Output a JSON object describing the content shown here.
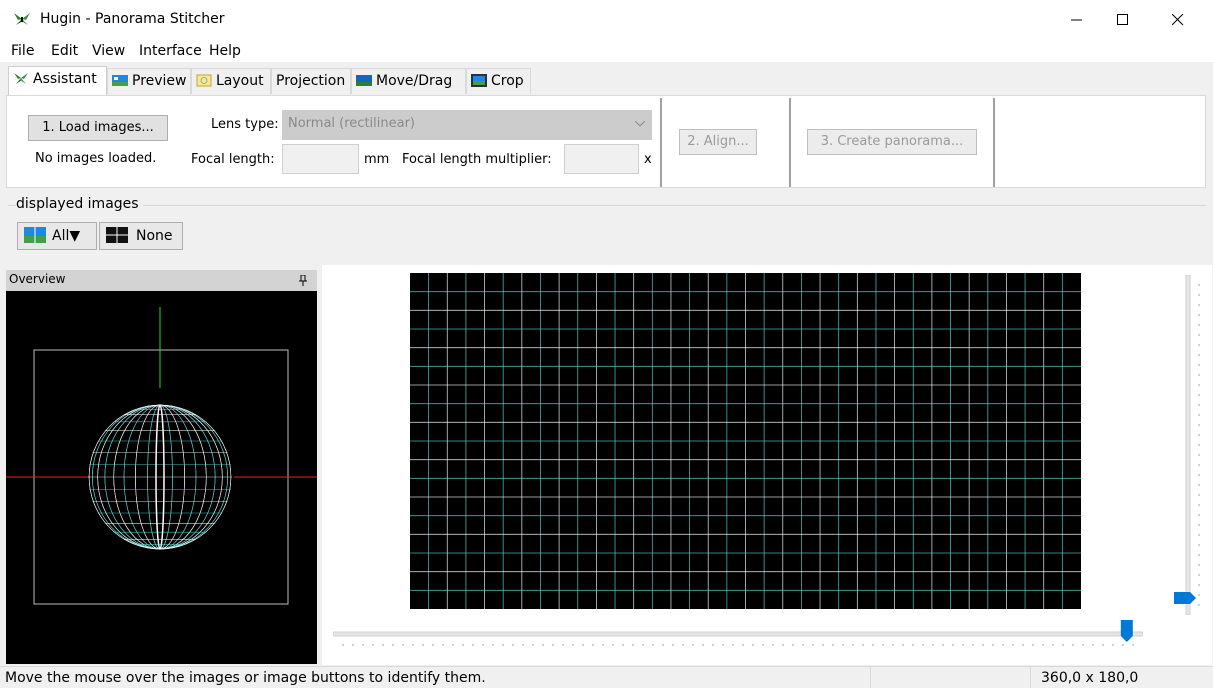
{
  "window": {
    "title": "Hugin - Panorama Stitcher"
  },
  "menu": [
    "File",
    "Edit",
    "View",
    "Interface",
    "Help"
  ],
  "tabs": [
    {
      "label": "Assistant",
      "icon": "hugin-icon"
    },
    {
      "label": "Preview",
      "icon": "preview-icon"
    },
    {
      "label": "Layout",
      "icon": "layout-icon"
    },
    {
      "label": "Projection",
      "icon": ""
    },
    {
      "label": "Move/Drag",
      "icon": "move-drag-icon"
    },
    {
      "label": "Crop",
      "icon": "crop-icon"
    }
  ],
  "assistant": {
    "load_button": "1. Load images...",
    "status": "No images loaded.",
    "lens_type_label": "Lens type:",
    "lens_type_value": "Normal (rectilinear)",
    "focal_length_label": "Focal length:",
    "focal_length_unit": "mm",
    "focal_length_value": "",
    "multiplier_label": "Focal length multiplier:",
    "multiplier_unit": "x",
    "multiplier_value": "",
    "align_button": "2. Align...",
    "create_button": "3. Create panorama..."
  },
  "displayed_images": {
    "title": "displayed images",
    "all_button": "All",
    "none_button": "None"
  },
  "overview": {
    "title": "Overview",
    "pin_icon": "pin-icon"
  },
  "preview": {
    "field_of_view": "360,0 x 180,0",
    "hfov_slider": 0.98,
    "vfov_slider": 0.95
  },
  "status": {
    "message": "Move the mouse over the images or image buttons to identify them.",
    "fov": "360,0 x 180,0"
  },
  "colors": {
    "accent": "#0078d7",
    "grid_cyan": "#5fd7d7",
    "grid_white": "#ffffff"
  }
}
